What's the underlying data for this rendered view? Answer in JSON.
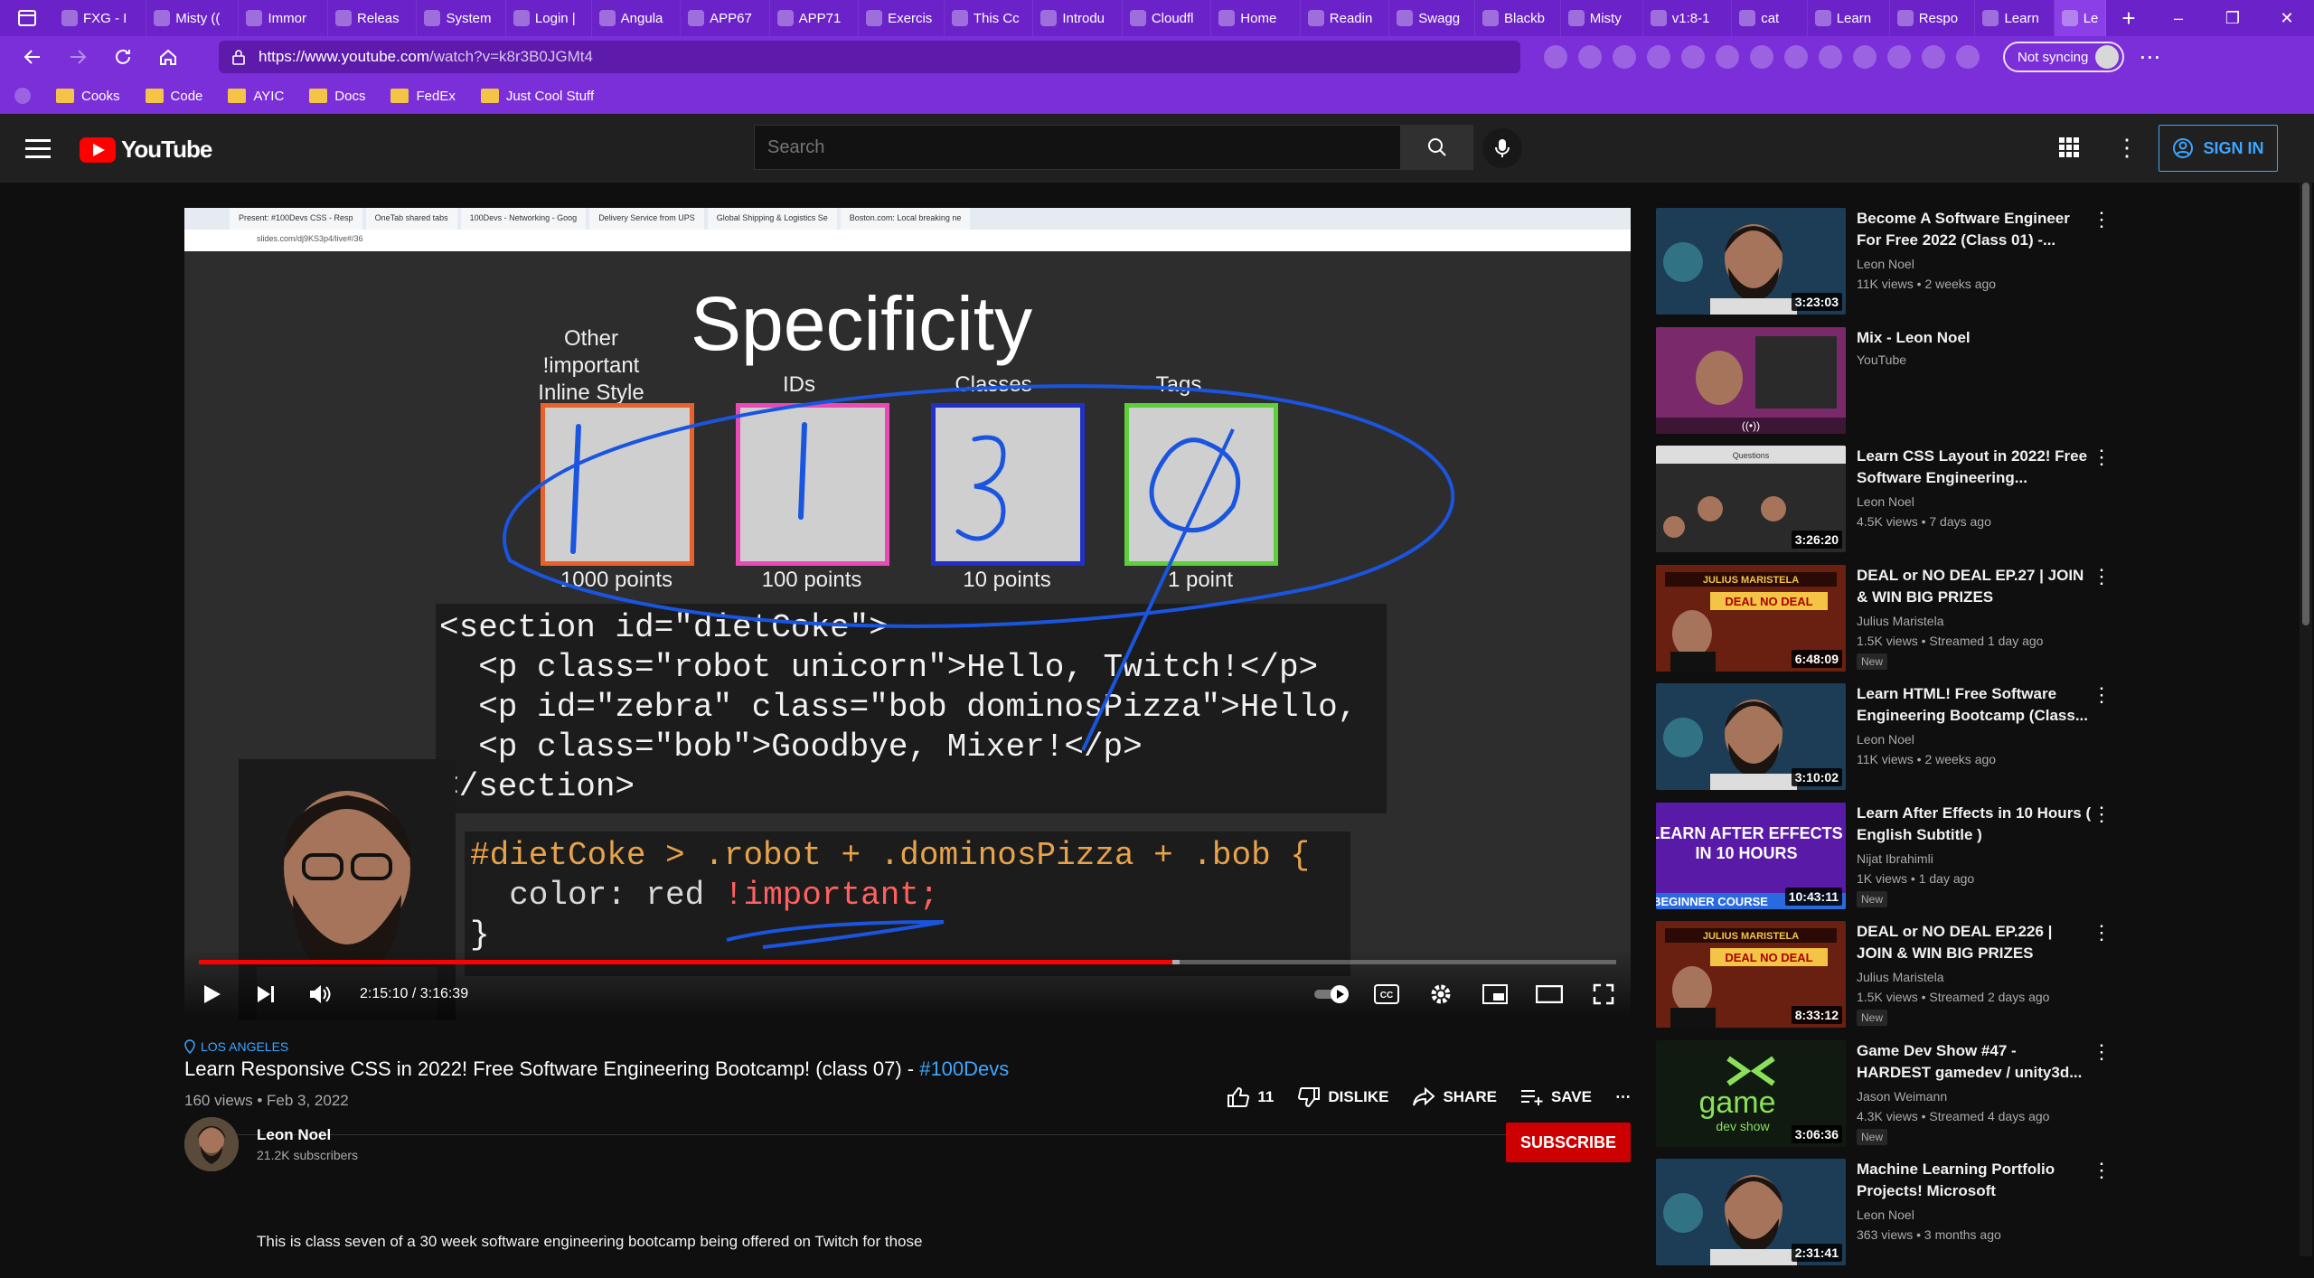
{
  "browser": {
    "tabs": [
      {
        "label": "FXG - I"
      },
      {
        "label": "Misty (("
      },
      {
        "label": "Immor"
      },
      {
        "label": "Releas"
      },
      {
        "label": "System"
      },
      {
        "label": "Login |"
      },
      {
        "label": "Angula"
      },
      {
        "label": "APP67"
      },
      {
        "label": "APP71"
      },
      {
        "label": "Exercis"
      },
      {
        "label": "This Cc"
      },
      {
        "label": "Introdu"
      },
      {
        "label": "Cloudfl"
      },
      {
        "label": "Home"
      },
      {
        "label": "Readin"
      },
      {
        "label": "Swagg"
      },
      {
        "label": "Blackb"
      },
      {
        "label": "Misty"
      },
      {
        "label": "v1:8-1"
      },
      {
        "label": "cat"
      },
      {
        "label": "Learn"
      },
      {
        "label": "Respo"
      },
      {
        "label": "Learn"
      },
      {
        "label": "Le"
      }
    ],
    "new_tab": "+",
    "win_min": "–",
    "win_max": "❐",
    "win_close": "✕",
    "url_host": "https://www.youtube.com",
    "url_path": "/watch?v=k8r3B0JGMt4",
    "sync_label": "Not syncing",
    "bookmarks": [
      "Cooks",
      "Code",
      "AYIC",
      "Docs",
      "FedEx",
      "Just Cool Stuff"
    ]
  },
  "yt_header": {
    "logo_text": "YouTube",
    "search_placeholder": "Search",
    "signin_label": "SIGN IN"
  },
  "slide": {
    "mini_tabs": [
      "Present: #100Devs CSS - Resp",
      "OneTab shared tabs",
      "100Devs - Networking - Goog",
      "Delivery Service from UPS",
      "Global Shipping & Logistics Se",
      "Boston.com: Local breaking ne"
    ],
    "mini_url": "slides.com/dj9KS3p4/live#/36",
    "title": "Specificity",
    "categories": [
      {
        "label": "Other\n!important\nInline Style",
        "digit": "1",
        "points": "1000 points"
      },
      {
        "label": "IDs",
        "digit": "1",
        "points": "100 points"
      },
      {
        "label": "Classes",
        "digit": "3",
        "points": "10 points"
      },
      {
        "label": "Tags",
        "digit": "0",
        "points": "1 point"
      }
    ],
    "code1": [
      "<section id=\"dietCoke\">",
      "  <p class=\"robot unicorn\">Hello, Twitch!</p>",
      "  <p id=\"zebra\" class=\"bob dominosPizza\">Hello,",
      "  <p class=\"bob\">Goodbye, Mixer!</p>",
      "</section>"
    ],
    "code2_selector": "#dietCoke > .robot + .dominosPizza + .bob {",
    "code2_prop": "  color: red ",
    "code2_important": "!important;",
    "code2_close": "}"
  },
  "player": {
    "time": "2:15:10 / 3:16:39",
    "progress": 0.687,
    "buffered": 0.692
  },
  "video": {
    "location": "LOS ANGELES",
    "title": "Learn Responsive CSS in 2022! Free Software Engineering Bootcamp! (class 07) - ",
    "hashtag": "#100Devs",
    "views_date": "160 views • Feb 3, 2022",
    "likes": "11",
    "dislike": "DISLIKE",
    "share": "SHARE",
    "save": "SAVE",
    "channel_name": "Leon Noel",
    "subscribers": "21.2K subscribers",
    "subscribe": "SUBSCRIBE",
    "description": "This is class seven of a 30 week software engineering bootcamp being offered on Twitch for those"
  },
  "recommendations": [
    {
      "title": "Become A Software Engineer For Free 2022 (Class 01) -...",
      "channel": "Leon Noel",
      "meta": "11K views • 2 weeks ago",
      "duration": "3:23:03",
      "new": "",
      "thumb_color": "#1d3c56"
    },
    {
      "title": "Mix - Leon Noel",
      "channel": "YouTube",
      "meta": "",
      "duration": "",
      "new": "",
      "thumb_color": "#7a2a6a"
    },
    {
      "title": "Learn CSS Layout in 2022! Free Software Engineering...",
      "channel": "Leon Noel",
      "meta": "4.5K views • 7 days ago",
      "duration": "3:26:20",
      "new": "",
      "thumb_color": "#2a2a2a"
    },
    {
      "title": "DEAL or NO DEAL EP.27 | JOIN & WIN BIG PRIZES",
      "channel": "Julius Maristela",
      "meta": "1.5K views • Streamed 1 day ago",
      "duration": "6:48:09",
      "new": "New",
      "thumb_color": "#6a2010"
    },
    {
      "title": "Learn HTML! Free Software Engineering Bootcamp (Class...",
      "channel": "Leon Noel",
      "meta": "11K views • 2 weeks ago",
      "duration": "3:10:02",
      "new": "",
      "thumb_color": "#1d3c56"
    },
    {
      "title": "Learn After Effects in 10 Hours ( English Subtitle )",
      "channel": "Nijat Ibrahimli",
      "meta": "1K views • 1 day ago",
      "duration": "10:43:11",
      "new": "New",
      "thumb_color": "#5a1aa8"
    },
    {
      "title": "DEAL or NO DEAL EP.226 | JOIN & WIN BIG PRIZES",
      "channel": "Julius Maristela",
      "meta": "1.5K views • Streamed 2 days ago",
      "duration": "8:33:12",
      "new": "New",
      "thumb_color": "#6a2010"
    },
    {
      "title": "Game Dev Show #47 - HARDEST gamedev / unity3d...",
      "channel": "Jason Weimann",
      "meta": "4.3K views • Streamed 4 days ago",
      "duration": "3:06:36",
      "new": "New",
      "thumb_color": "#101a10"
    },
    {
      "title": "Machine Learning Portfolio Projects! Microsoft Sponsored...",
      "channel": "Leon Noel",
      "meta": "363 views • 3 months ago",
      "duration": "2:31:41",
      "new": "",
      "thumb_color": "#1d3c56"
    }
  ],
  "thumb_texts": {
    "after_effects": "LEARN AFTER EFFECTS IN 10 HOURS",
    "beginner": "BEGINNER COURSE",
    "deal": "DEAL NO DEAL",
    "julius": "JULIUS MARISTELA",
    "game": "game",
    "devshow": "dev show",
    "questions": "Questions"
  },
  "colors": {
    "accent_red": "#ff0000",
    "browser_purple": "#7a2fd8",
    "link_blue": "#3ea6ff",
    "box_orange": "#e8602c",
    "box_pink": "#e84cb4",
    "box_blue": "#2030c8",
    "box_green": "#5ccf3a",
    "pen_blue": "#1a55e0"
  }
}
